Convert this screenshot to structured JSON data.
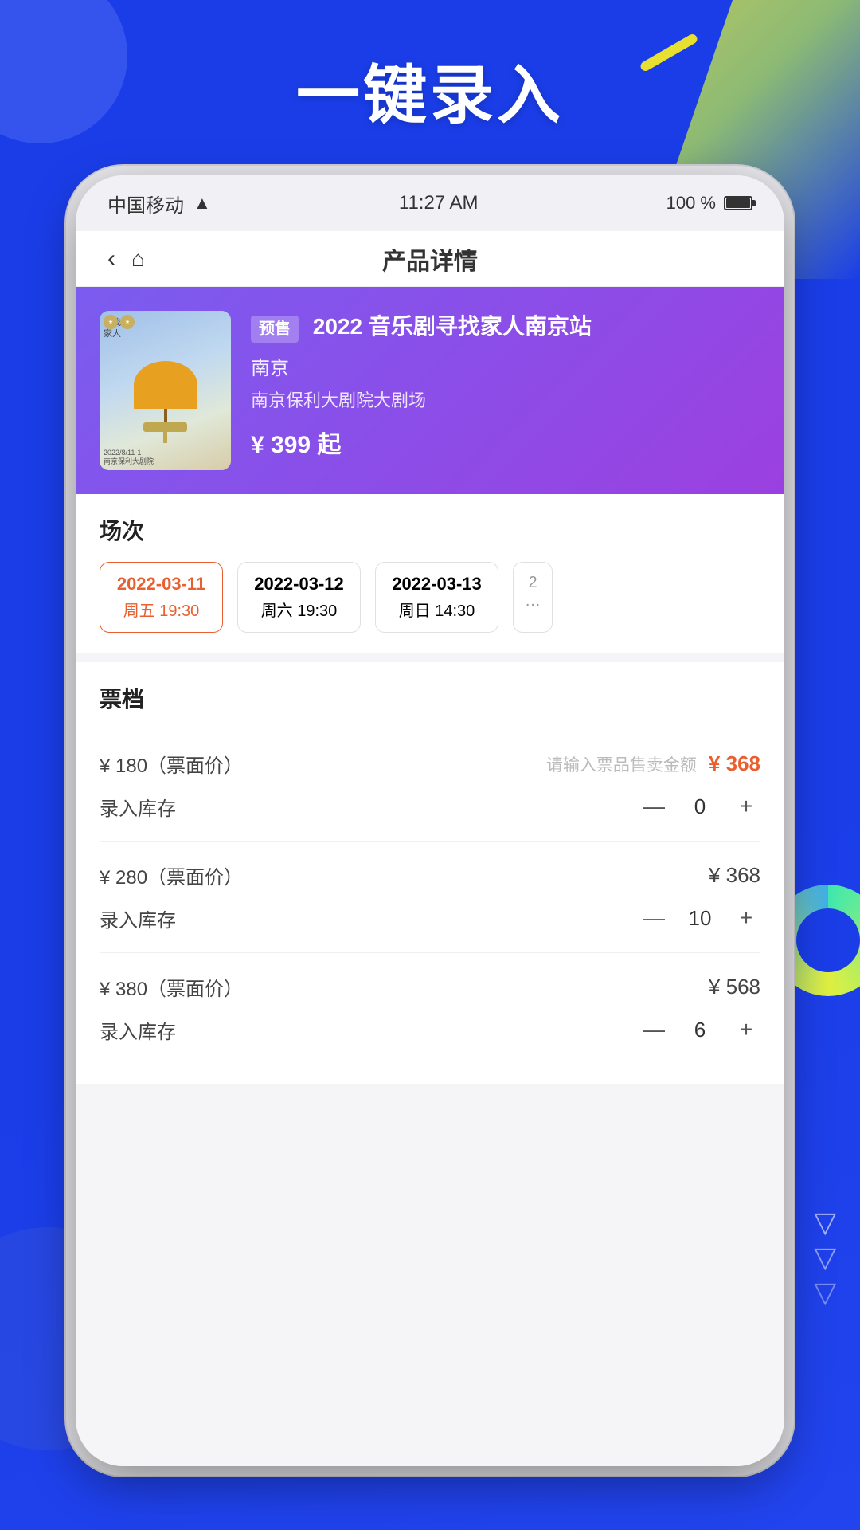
{
  "background": {
    "title": "一键录入"
  },
  "status_bar": {
    "carrier": "中国移动",
    "time": "11:27 AM",
    "battery": "100 %"
  },
  "nav": {
    "title": "产品详情",
    "back_label": "‹",
    "home_label": "⌂"
  },
  "product": {
    "presale_badge": "预售",
    "name": "2022 音乐剧寻找家人南京站",
    "city": "南京",
    "venue": "南京保利大剧院大剧场",
    "price": "¥ 399 起",
    "cover_lines": [
      "寻找",
      "家人"
    ],
    "cover_bottom": "2022/8/11-1\n南京保利大剧院"
  },
  "sessions": {
    "title": "场次",
    "dates": [
      {
        "date": "2022-03-11",
        "day": "周五 19:30",
        "active": true
      },
      {
        "date": "2022-03-12",
        "day": "周六 19:30",
        "active": false
      },
      {
        "date": "2022-03-13",
        "day": "周日 14:30",
        "active": false
      }
    ],
    "partial": "2"
  },
  "tickets": {
    "title": "票档",
    "tiers": [
      {
        "face_price": "¥ 180（票面价）",
        "input_placeholder": "请输入票品售卖金额",
        "sell_price": "¥ 368",
        "inventory_label": "录入库存",
        "inventory_value": "0",
        "has_input": true
      },
      {
        "face_price": "¥ 280（票面价）",
        "input_placeholder": "",
        "sell_price": "¥ 368",
        "inventory_label": "录入库存",
        "inventory_value": "10",
        "has_input": false
      },
      {
        "face_price": "¥ 380（票面价）",
        "input_placeholder": "",
        "sell_price": "¥ 568",
        "inventory_label": "录入库存",
        "inventory_value": "6",
        "has_input": false
      }
    ]
  }
}
